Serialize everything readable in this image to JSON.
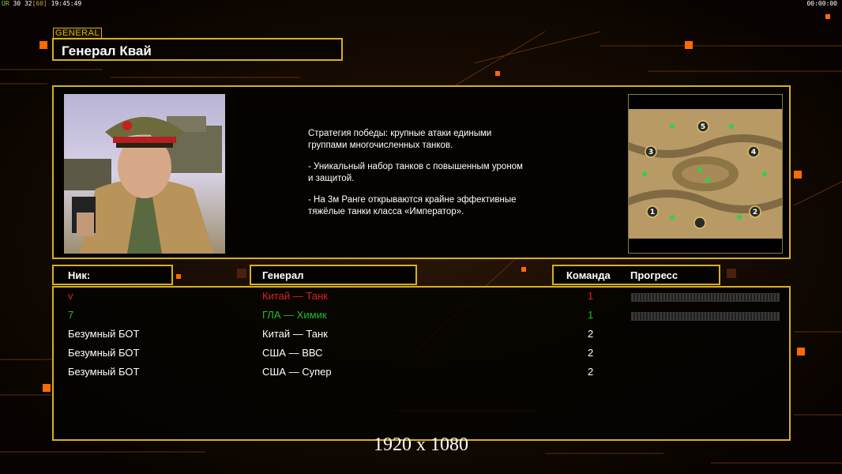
{
  "hud": {
    "fps_label": "ÜR",
    "fps1": "30",
    "fps2": "32",
    "fps3": "[60]",
    "clock": "19:45:49",
    "timer": "00:00:00"
  },
  "general": {
    "tag": "GENERAL",
    "name": "Генерал Квай"
  },
  "description": [
    "Стратегия победы: крупные атаки едиными\n группами многочисленных танков.",
    "- Уникальный набор танков с повышенным уроном\n и защитой.",
    "- На 3м Ранге открываются крайне эффективные\n тяжёлые танки класса «Император»."
  ],
  "columns": {
    "nick": "Ник:",
    "general": "Генерал",
    "team": "Команда",
    "progress": "Прогресс"
  },
  "players": [
    {
      "nick": "v",
      "general": "Китай — Танк",
      "team": "1",
      "color": "#e02020",
      "show_progress": true,
      "progress": 0
    },
    {
      "nick": "7",
      "general": "ГЛА — Химик",
      "team": "1",
      "color": "#20c020",
      "show_progress": true,
      "progress": 0
    },
    {
      "nick": "Безумный БОТ",
      "general": "Китай — Танк",
      "team": "2",
      "color": "#ffffff",
      "show_progress": false
    },
    {
      "nick": "Безумный БОТ",
      "general": "США — ВВС",
      "team": "2",
      "color": "#ffffff",
      "show_progress": false
    },
    {
      "nick": "Безумный БОТ",
      "general": "США — Супер",
      "team": "2",
      "color": "#ffffff",
      "show_progress": false
    }
  ],
  "minimap": {
    "spawns": [
      "1",
      "2",
      "3",
      "4",
      "5"
    ]
  },
  "resolution": "1920 x 1080",
  "colors": {
    "accent": "#d6b01c",
    "orange": "#ff6a00",
    "red_player": "#e02020",
    "green_player": "#20c020"
  }
}
